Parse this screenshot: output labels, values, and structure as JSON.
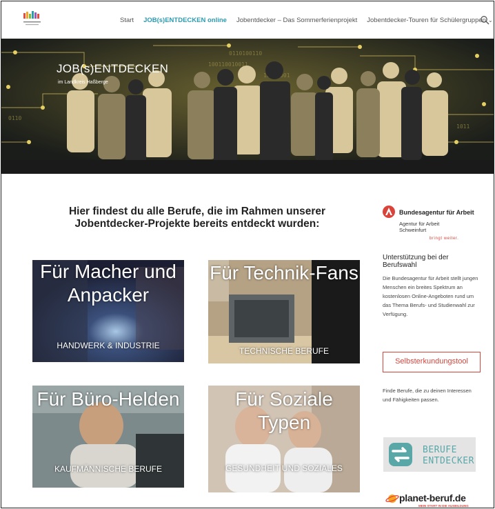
{
  "nav": {
    "items": [
      {
        "label": "Start",
        "active": false
      },
      {
        "label": "JOB(s)ENTDECKEN online",
        "active": true
      },
      {
        "label": "Jobentdecker – Das Sommerferienprojekt",
        "active": false
      },
      {
        "label": "Jobentdecker-Touren für Schülergruppen",
        "active": false,
        "has_dropdown": true
      }
    ],
    "search_icon": "search-icon"
  },
  "hero": {
    "title": "JOB(s)ENTDECKEN",
    "subtitle": "im Landkreis Haßberge"
  },
  "main": {
    "intro": "Hier findest du alle Berufe, die im Rahmen unserer Jobentdecker-Projekte bereits entdeckt wurden:",
    "cards": [
      {
        "title": "Für Macher und Anpacker",
        "category": "HANDWERK & INDUSTRIE"
      },
      {
        "title": "Für Technik-Fans",
        "category": "TECHNISCHE BERUFE"
      },
      {
        "title": "Für Büro-Helden",
        "category": "KAUFMÄNNISCHE BERUFE"
      },
      {
        "title": "Für Soziale Typen",
        "category": "GESUNDHEIT UND SOZIALES"
      }
    ]
  },
  "sidebar": {
    "ba_name": "Bundesagentur für Arbeit",
    "ba_sub1": "Agentur für Arbeit",
    "ba_sub2": "Schweinfurt",
    "ba_slogan": "bringt weiter.",
    "heading": "Unterstützung bei der Berufswahl",
    "text": "Die Bundesagentur für Arbeit stellt jungen Menschen ein breites Spektrum an kostenlosen Online-Angeboten rund um das Thema Berufs- und Studienwahl zur Verfügung.",
    "button": "Selbsterkundungstool",
    "text2": "Finde Berufe, die zu deinen Interessen und Fähigkeiten passen.",
    "berufe_line1": "BERUFE",
    "berufe_line2": "ENTDECKER",
    "planet_name": "planet-beruf.de",
    "planet_slogan": "MEIN START IN DIE AUSBILDUNG"
  },
  "colors": {
    "accent": "#2b9bb0",
    "ba_red": "#d9443a",
    "berufe_teal": "#5aa7a7"
  }
}
